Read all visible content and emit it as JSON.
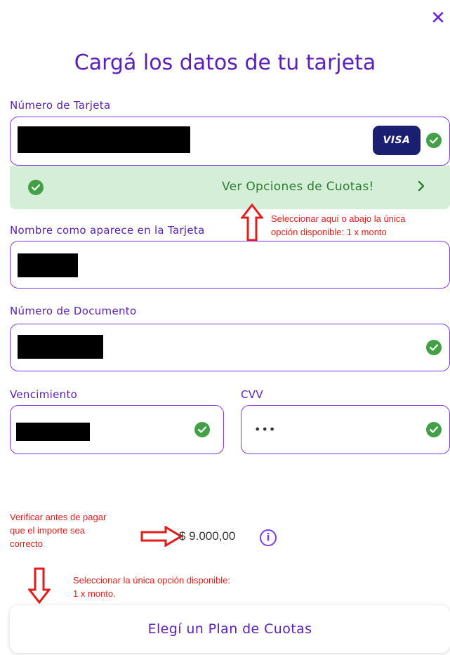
{
  "header": {
    "close_glyph": "✕",
    "title": "Cargá los datos de tu tarjeta"
  },
  "card_number": {
    "label": "Número de Tarjeta",
    "brand": "VISA",
    "valid": true
  },
  "cuotas_bar": {
    "label": "Ver Opciones de Cuotas!",
    "chevron": "›"
  },
  "annotations": {
    "cuotas_hint": [
      "Seleccionar aquí o abajo la única",
      "opción disponible: 1 x monto"
    ],
    "amount_hint": [
      "Verificar antes de pagar",
      "que el importe sea",
      "correcto"
    ],
    "plan_hint": [
      "Seleccionar la única opción disponible:",
      "1 x monto."
    ]
  },
  "cardholder_name": {
    "label": "Nombre como aparece en la Tarjeta"
  },
  "document_number": {
    "label": "Número de Documento",
    "valid": true
  },
  "expiry": {
    "label": "Vencimiento",
    "valid": true
  },
  "cvv": {
    "label": "CVV",
    "value": "•••",
    "valid": true
  },
  "amount": {
    "value": "$ 9.000,00",
    "info_glyph": "i"
  },
  "plan_button": {
    "label": "Elegí un Plan de Cuotas"
  },
  "colors": {
    "accent": "#7c3aed",
    "title": "#5b21b6",
    "success": "#43a047",
    "success_bg": "#d5eed7",
    "annotation": "#e31b1b",
    "visa": "#1a1f71"
  }
}
